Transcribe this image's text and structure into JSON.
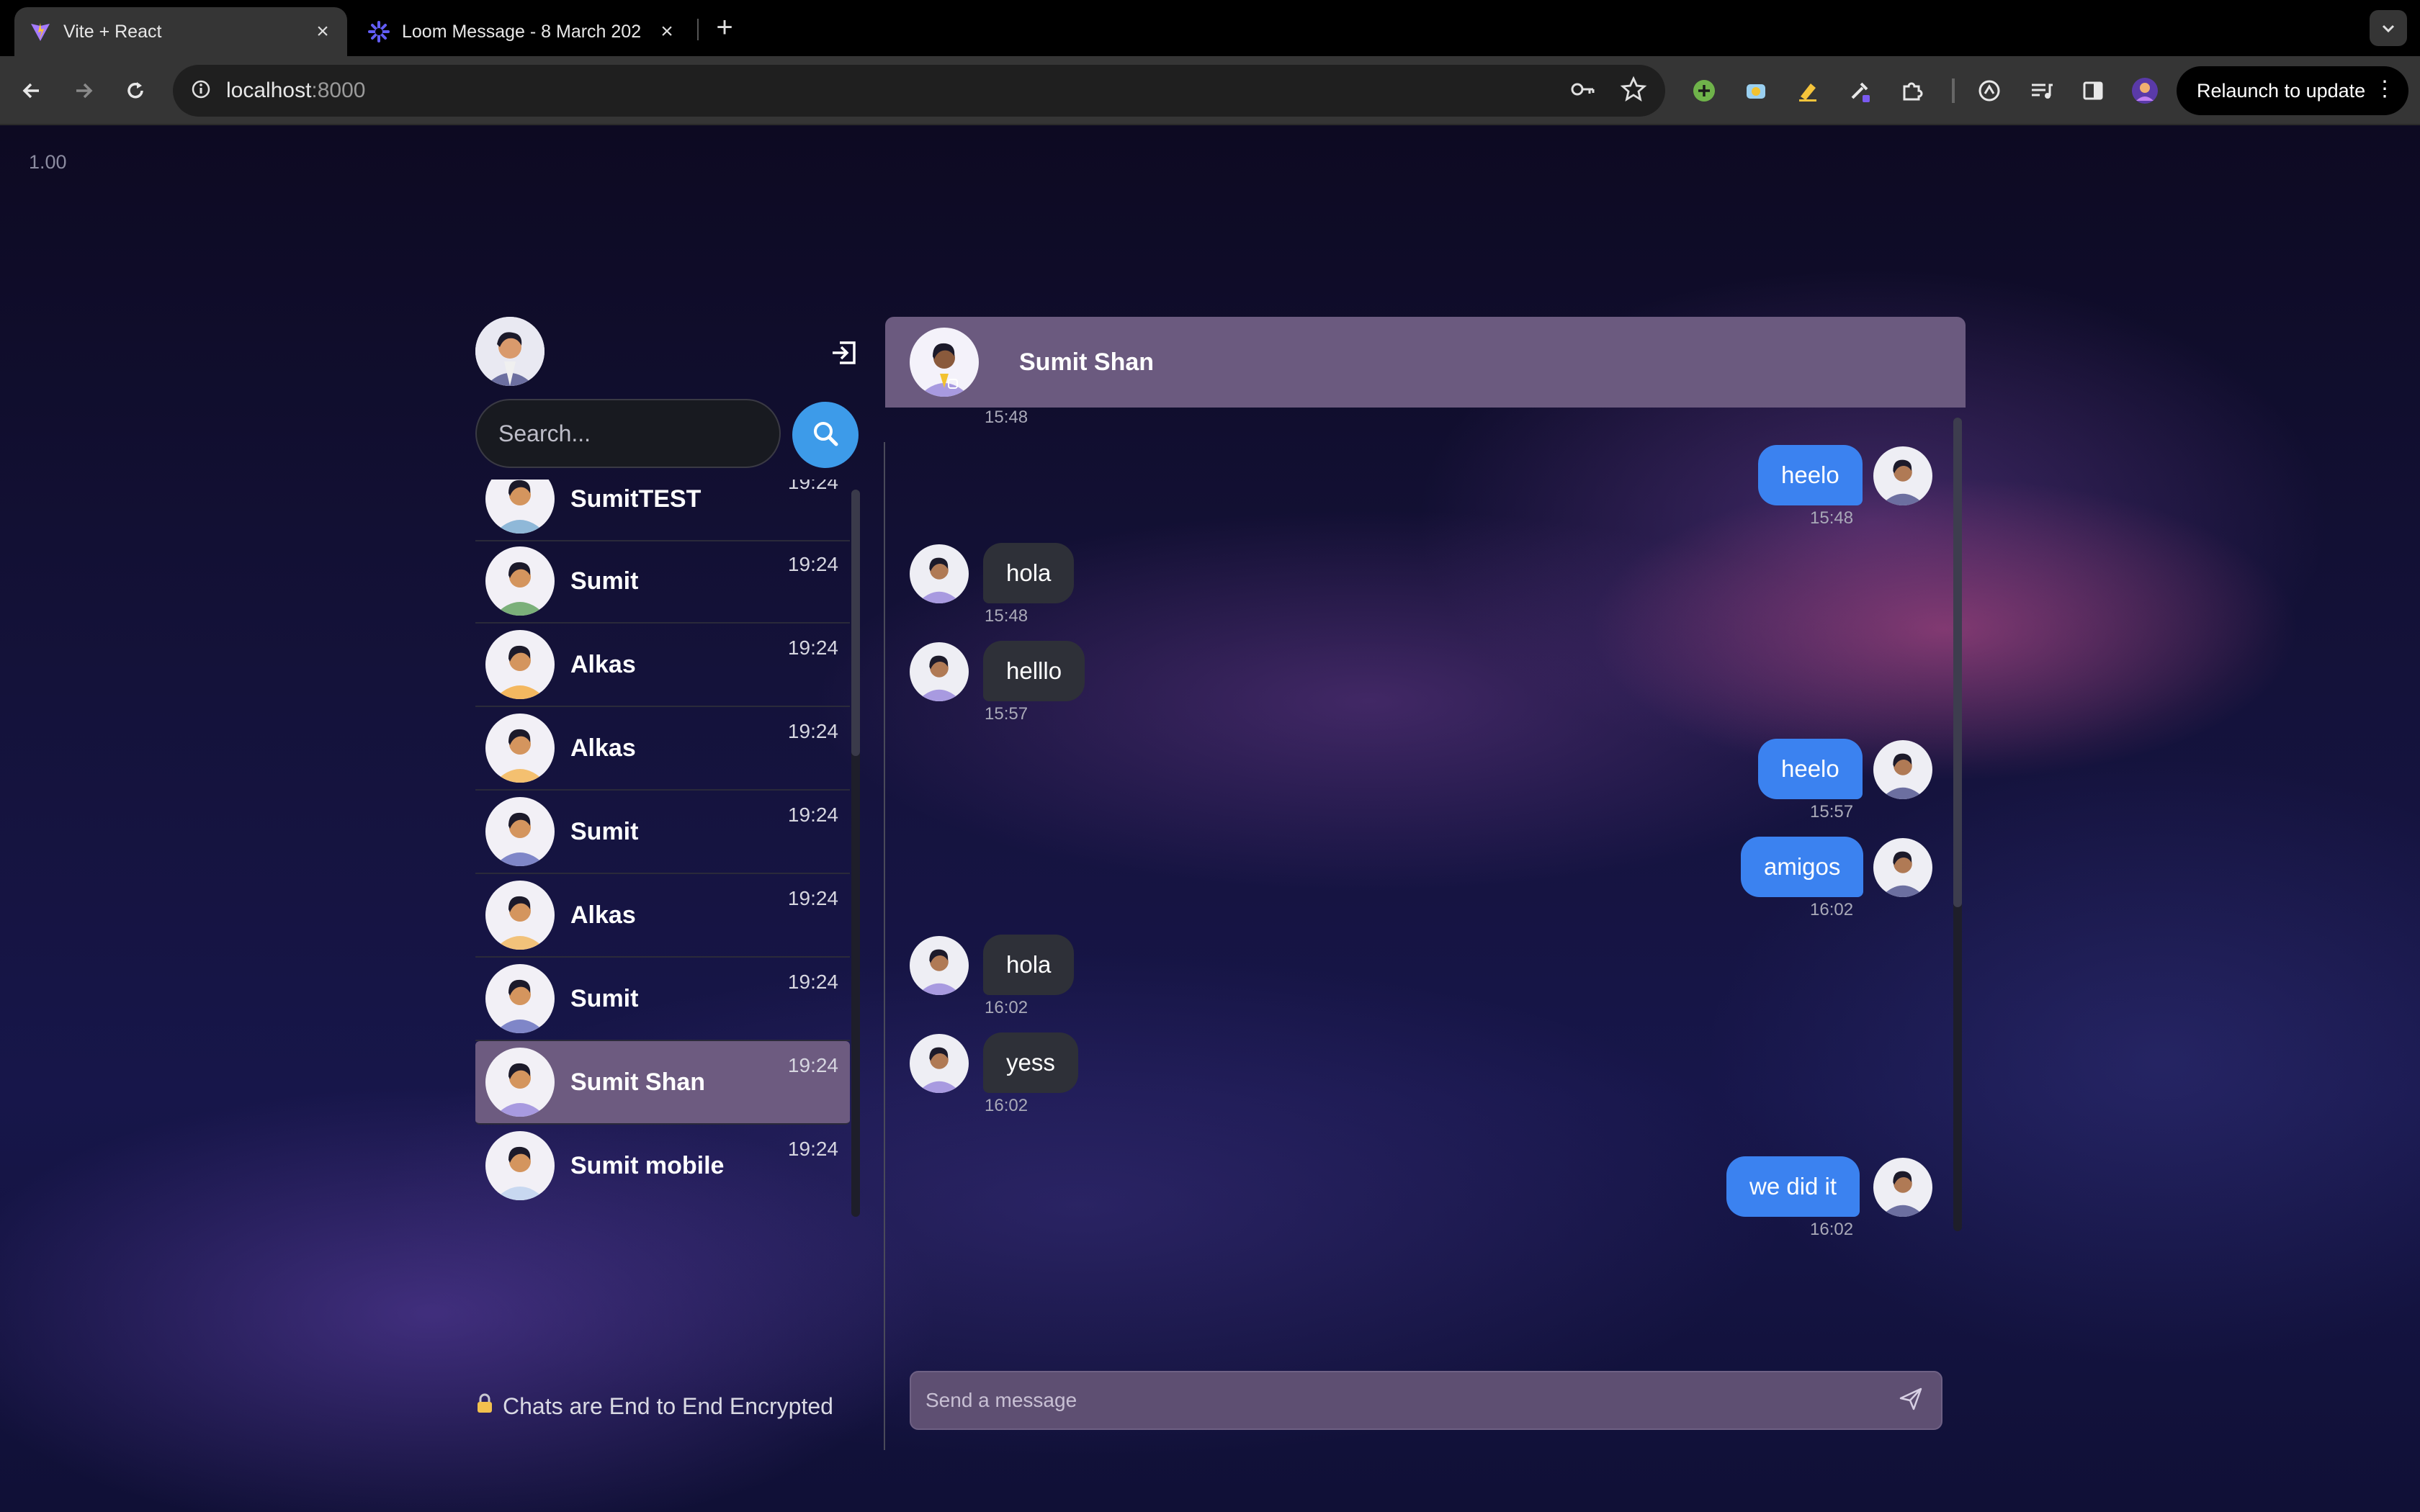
{
  "browser": {
    "tabs": [
      {
        "title": "Vite + React",
        "active": true,
        "favicon": "vite-logo-icon"
      },
      {
        "title": "Loom Message - 8 March 202",
        "active": false,
        "favicon": "loom-logo-icon"
      }
    ],
    "address": {
      "host": "localhost",
      "port": ":8000"
    },
    "relaunch_label": "Relaunch to update"
  },
  "page": {
    "zoom_label": "1.00",
    "search": {
      "placeholder": "Search..."
    },
    "chats": [
      {
        "name": "SumitTEST",
        "time": "19:24",
        "avatar_color": "#8fb8d8"
      },
      {
        "name": "Sumit",
        "time": "19:24",
        "avatar_color": "#7bb07a"
      },
      {
        "name": "Alkas",
        "time": "19:24",
        "avatar_color": "#f4b860"
      },
      {
        "name": "Alkas",
        "time": "19:24",
        "avatar_color": "#f4c070"
      },
      {
        "name": "Sumit",
        "time": "19:24",
        "avatar_color": "#7f86c8"
      },
      {
        "name": "Alkas",
        "time": "19:24",
        "avatar_color": "#f2c27a"
      },
      {
        "name": "Sumit",
        "time": "19:24",
        "avatar_color": "#7f86c8"
      },
      {
        "name": "Sumit Shan",
        "time": "19:24",
        "avatar_color": "#a89ae0",
        "selected": true
      },
      {
        "name": "Sumit mobile",
        "time": "19:24",
        "avatar_color": "#c8d8f0"
      }
    ],
    "encryption_note": "Chats are End to End Encrypted",
    "conversation": {
      "title": "Sumit Shan",
      "top_time": "15:48",
      "messages": [
        {
          "text": "heelo",
          "time": "15:48",
          "from": "me"
        },
        {
          "text": "hola",
          "time": "15:48",
          "from": "them"
        },
        {
          "text": "helllo",
          "time": "15:57",
          "from": "them"
        },
        {
          "text": "heelo",
          "time": "15:57",
          "from": "me"
        },
        {
          "text": "amigos",
          "time": "16:02",
          "from": "me"
        },
        {
          "text": "hola",
          "time": "16:02",
          "from": "them"
        },
        {
          "text": "yess",
          "time": "16:02",
          "from": "them"
        },
        {
          "text": "we did it",
          "time": "16:02",
          "from": "me"
        }
      ],
      "composer_placeholder": "Send a message"
    }
  }
}
